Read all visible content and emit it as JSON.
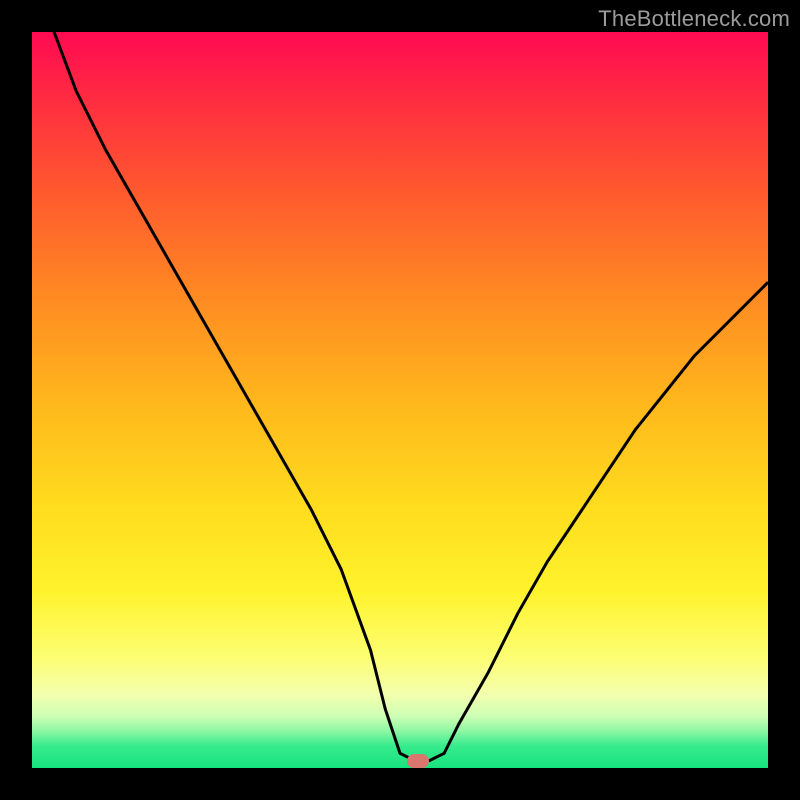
{
  "watermark": {
    "text": "TheBottleneck.com"
  },
  "marker": {
    "x_pct": 52.5,
    "y_pct": 99.0
  },
  "chart_data": {
    "type": "line",
    "title": "",
    "xlabel": "",
    "ylabel": "",
    "xlim": [
      0,
      100
    ],
    "ylim": [
      0,
      100
    ],
    "grid": false,
    "legend": false,
    "note": "Axes have no tick labels; x and y are treated as 0–100% of the plot area. y=100 is the top (worst / red), y=0 is the bottom (best / green). Values are read from pixel positions.",
    "series": [
      {
        "name": "bottleneck-curve",
        "x": [
          0,
          3,
          6,
          10,
          14,
          18,
          22,
          26,
          30,
          34,
          38,
          42,
          46,
          48,
          50,
          52,
          54,
          56,
          58,
          62,
          66,
          70,
          74,
          78,
          82,
          86,
          90,
          94,
          98,
          100
        ],
        "y": [
          110,
          100,
          92,
          84,
          77,
          70,
          63,
          56,
          49,
          42,
          35,
          27,
          16,
          8,
          2,
          1,
          1,
          2,
          6,
          13,
          21,
          28,
          34,
          40,
          46,
          51,
          56,
          60,
          64,
          66
        ]
      }
    ],
    "background_gradient": {
      "orientation": "vertical",
      "stops": [
        {
          "pct": 0,
          "color": "#ff0a52"
        },
        {
          "pct": 10,
          "color": "#ff2f3f"
        },
        {
          "pct": 22,
          "color": "#ff5a2e"
        },
        {
          "pct": 36,
          "color": "#ff8a22"
        },
        {
          "pct": 50,
          "color": "#ffb61c"
        },
        {
          "pct": 64,
          "color": "#ffdb1e"
        },
        {
          "pct": 76,
          "color": "#fff32c"
        },
        {
          "pct": 85,
          "color": "#fdfe73"
        },
        {
          "pct": 90,
          "color": "#f3ffae"
        },
        {
          "pct": 93,
          "color": "#cdffb5"
        },
        {
          "pct": 95,
          "color": "#8cf7a3"
        },
        {
          "pct": 97,
          "color": "#37eb8e"
        },
        {
          "pct": 100,
          "color": "#16e37e"
        }
      ]
    },
    "marker": {
      "x": 52.5,
      "y": 1,
      "color": "#d9766e"
    }
  }
}
